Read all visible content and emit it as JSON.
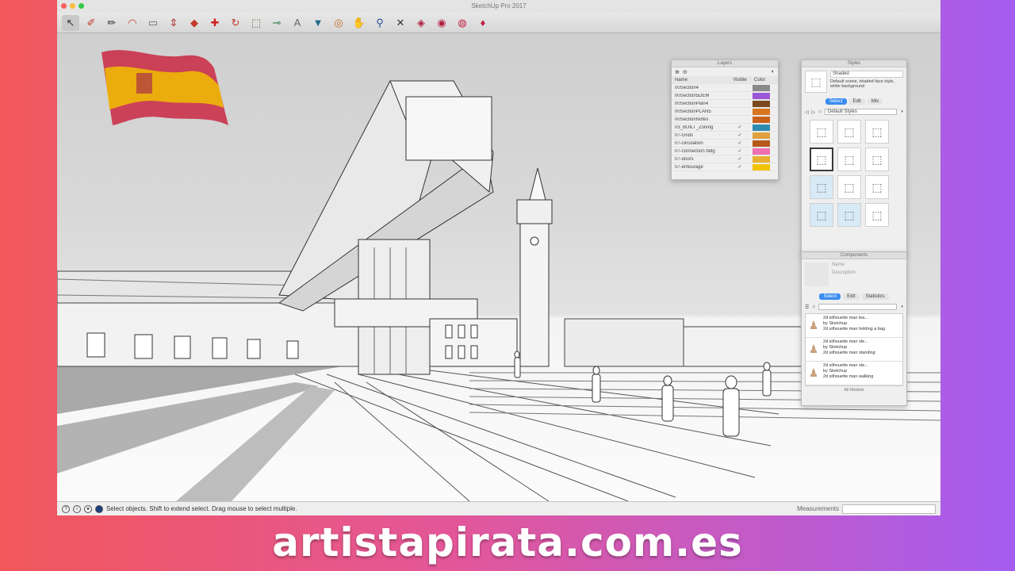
{
  "app": {
    "title": "SketchUp Pro 2017"
  },
  "toolbar": {
    "tools": [
      {
        "icon": "select-arrow-icon",
        "glyph": "↖"
      },
      {
        "icon": "eraser-icon",
        "glyph": "✐"
      },
      {
        "icon": "pencil-line-icon",
        "glyph": "✏"
      },
      {
        "icon": "arc-icon",
        "glyph": "◠"
      },
      {
        "icon": "rectangle-icon",
        "glyph": "▭"
      },
      {
        "icon": "push-pull-icon",
        "glyph": "⇕"
      },
      {
        "icon": "follow-me-icon",
        "glyph": "◆"
      },
      {
        "icon": "move-icon",
        "glyph": "✚"
      },
      {
        "icon": "rotate-icon",
        "glyph": "↻"
      },
      {
        "icon": "scale-icon",
        "glyph": "⬚"
      },
      {
        "icon": "tape-measure-icon",
        "glyph": "⊸"
      },
      {
        "icon": "text-icon",
        "glyph": "A"
      },
      {
        "icon": "paint-bucket-icon",
        "glyph": "▼"
      },
      {
        "icon": "orbit-icon",
        "glyph": "◎"
      },
      {
        "icon": "pan-icon",
        "glyph": "✋"
      },
      {
        "icon": "zoom-icon",
        "glyph": "⚲"
      },
      {
        "icon": "zoom-extents-icon",
        "glyph": "✕"
      },
      {
        "icon": "warehouse-icon",
        "glyph": "◈"
      },
      {
        "icon": "extension-warehouse-icon",
        "glyph": "◉"
      },
      {
        "icon": "layout-icon",
        "glyph": "◍"
      },
      {
        "icon": "ruby-icon",
        "glyph": "♦"
      }
    ]
  },
  "layers_panel": {
    "title": "Layers",
    "col_name": "Name",
    "col_visible": "Visible",
    "col_color": "Color",
    "rows": [
      {
        "name": "00Section4",
        "visible": "",
        "color": "#8a8a8a"
      },
      {
        "name": "00Section5DEM",
        "visible": "",
        "color": "#9b58d6"
      },
      {
        "name": "00SectionPlan4",
        "visible": "",
        "color": "#7a4a1e"
      },
      {
        "name": "00SectionPLAN5",
        "visible": "",
        "color": "#d8751e"
      },
      {
        "name": "00SectionNotes",
        "visible": "",
        "color": "#c9601a"
      },
      {
        "name": "03_BUILT_Zoning",
        "visible": "✓",
        "color": "#2e8bb0"
      },
      {
        "name": "07-Grids",
        "visible": "✓",
        "color": "#e0a040"
      },
      {
        "name": "07-circulation",
        "visible": "✓",
        "color": "#b5581a"
      },
      {
        "name": "07-connection bldg",
        "visible": "✓",
        "color": "#f06fb0"
      },
      {
        "name": "07-doors",
        "visible": "✓",
        "color": "#e8b030"
      },
      {
        "name": "07-entourage",
        "visible": "✓",
        "color": "#f2c300"
      }
    ]
  },
  "styles_panel": {
    "title": "Styles",
    "style_name": "Shaded",
    "style_desc": "Default scene, shaded face style, white background",
    "tabs": [
      "Select",
      "Edit",
      "Mix"
    ],
    "active_tab": "Select",
    "dropdown": "Default Styles"
  },
  "components_panel": {
    "title": "Components",
    "name_label": "Name",
    "desc_label": "Description",
    "tabs": [
      "Select",
      "Edit",
      "Statistics"
    ],
    "active_tab": "Select",
    "items": [
      {
        "title": "2d silhouette man lea...",
        "author": "by Sketchup",
        "desc": "2d silhouette man holding a bag"
      },
      {
        "title": "2d silhouette man ste...",
        "author": "by Sketchup",
        "desc": "2d silhouette man standing"
      },
      {
        "title": "2d silhouette man ste...",
        "author": "by Sketchup",
        "desc": "2d silhouette man walking"
      }
    ],
    "footer": "All Models"
  },
  "status": {
    "message": "Select objects. Shift to extend select. Drag mouse to select multiple.",
    "measurements_label": "Measurements",
    "measurements_value": ""
  },
  "watermark": "artistapirata.com.es"
}
